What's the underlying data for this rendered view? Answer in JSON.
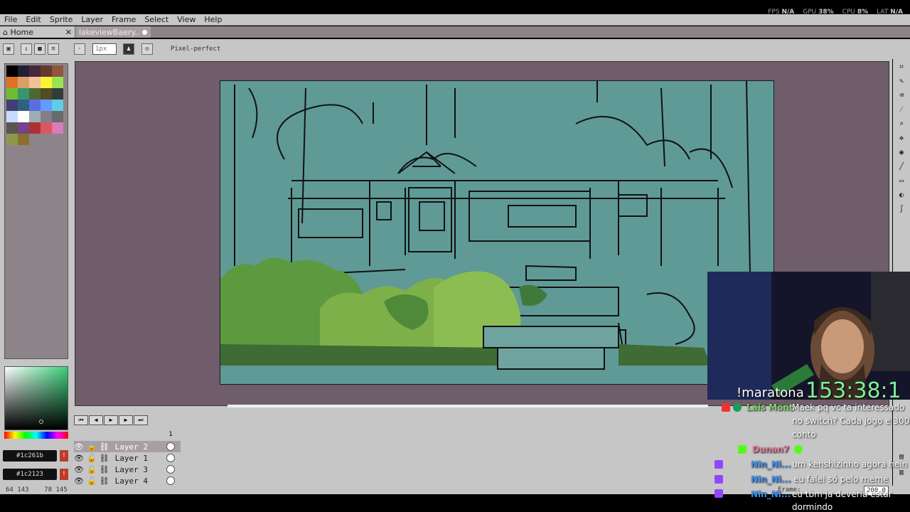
{
  "perf": {
    "fps_label": "FPS",
    "fps": "N/A",
    "gpu_label": "GPU",
    "gpu": "38%",
    "cpu_label": "CPU",
    "cpu": "8%",
    "lat_label": "LAT",
    "lat": "N/A"
  },
  "menu": [
    "File",
    "Edit",
    "Sprite",
    "Layer",
    "Frame",
    "Select",
    "View",
    "Help"
  ],
  "tabs": {
    "home": "Home",
    "file": "lakeviewBaery.."
  },
  "context": {
    "brush_size_placeholder": "1px",
    "pixel_perfect": "Pixel-perfect"
  },
  "palette_colors": [
    "#000000",
    "#222034",
    "#45283c",
    "#663931",
    "#8f563b",
    "#df7126",
    "#d9a066",
    "#eec39a",
    "#fbf236",
    "#99e550",
    "#6abe30",
    "#37946e",
    "#4b692f",
    "#524b24",
    "#323c39",
    "#3f3f74",
    "#306082",
    "#5b6ee1",
    "#639bff",
    "#5fcde4",
    "#cbdbfc",
    "#ffffff",
    "#9badb7",
    "#847e87",
    "#696a6a",
    "#595652",
    "#76428a",
    "#ac3232",
    "#d95763",
    "#d77bba",
    "#8f974a",
    "#8a6f30"
  ],
  "colors": {
    "fg_hex": "#1c261b",
    "bg_hex": "#1c2123"
  },
  "timeline": {
    "frame_number": "1",
    "layers": [
      {
        "name": "Layer 2",
        "active": true
      },
      {
        "name": "Layer 1",
        "active": false
      },
      {
        "name": "Layer 3",
        "active": false
      },
      {
        "name": "Layer 4",
        "active": false
      }
    ]
  },
  "status": {
    "coords": "64 143",
    "size": "78 145"
  },
  "frame_control": {
    "label": "Frame:",
    "zoom": "200.0"
  },
  "stream": {
    "marathon": "!maratona",
    "timer": "153:38:1"
  },
  "chat": [
    {
      "user": "Laís Mont",
      "text_lines": [
        "Maek pq vc ta interessado",
        "no switch? Cada jogo e 300",
        "conto"
      ]
    },
    {
      "user": "Dunan7",
      "text_lines": []
    },
    {
      "user": "Nin_Ni...",
      "text_lines": [
        "um kenshizinho agora hein"
      ]
    },
    {
      "user": "Nin_Ni...",
      "text_lines": [
        "eu falei só pelo meme"
      ]
    },
    {
      "user": "Nin_Ni...",
      "text_lines": [
        "eu tbm ja deveria estar",
        "dormindo"
      ]
    }
  ]
}
